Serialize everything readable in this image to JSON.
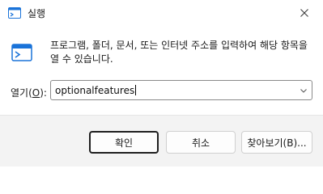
{
  "window": {
    "title": "실행",
    "close_icon": "close-icon"
  },
  "body": {
    "description": "프로그램, 폴더, 문서, 또는 인터넷 주소를 입력하여 해당 항목을 열 수 있습니다."
  },
  "open_field": {
    "label_prefix": "열기(",
    "label_accel": "O",
    "label_suffix": "):",
    "value": "optionalfeatures"
  },
  "buttons": {
    "ok": "확인",
    "cancel": "취소",
    "browse": "찾아보기(B)..."
  },
  "colors": {
    "accent": "#1a73d9",
    "footer_bg": "#f3f3f3"
  }
}
